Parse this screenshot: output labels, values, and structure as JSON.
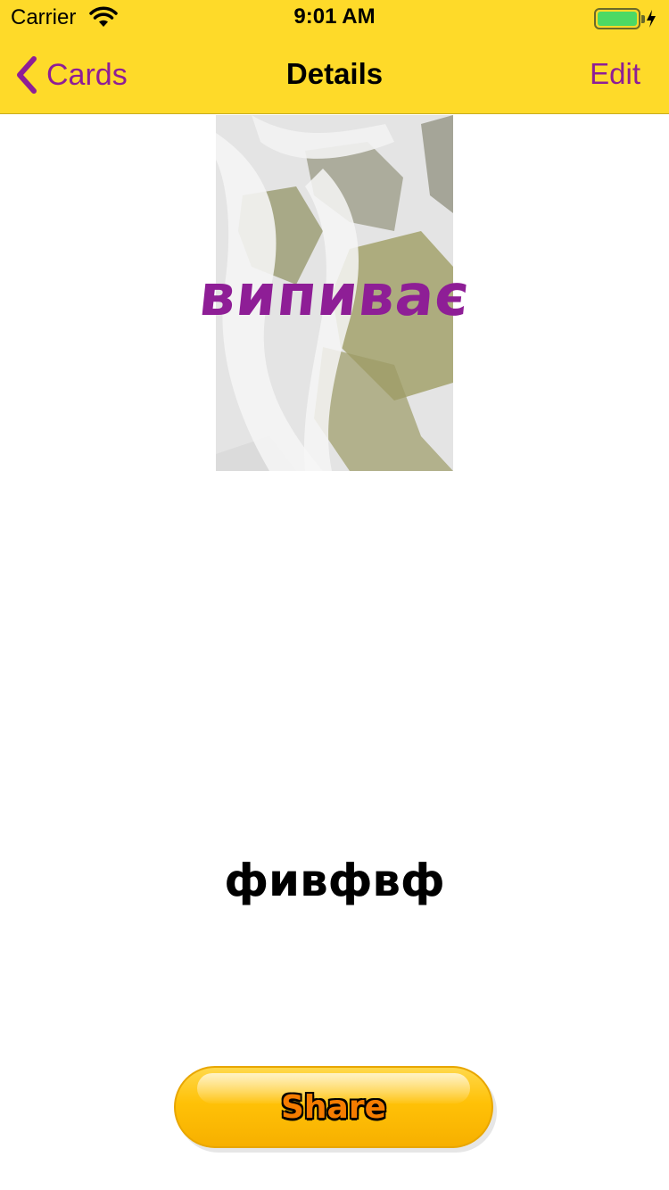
{
  "status_bar": {
    "carrier": "Carrier",
    "time": "9:01 AM",
    "icons": [
      "wifi-icon",
      "battery-icon",
      "charging-bolt-icon"
    ]
  },
  "nav_bar": {
    "back_label": "Cards",
    "title": "Details",
    "edit_label": "Edit",
    "background_color": "#FEDA29",
    "accent_color": "#8E1E96"
  },
  "card": {
    "word": "випиває",
    "translation": "фивфвф",
    "image_description_icon": "waterfall-image"
  },
  "share_button": {
    "label": "Share",
    "color": "#FFC107"
  }
}
